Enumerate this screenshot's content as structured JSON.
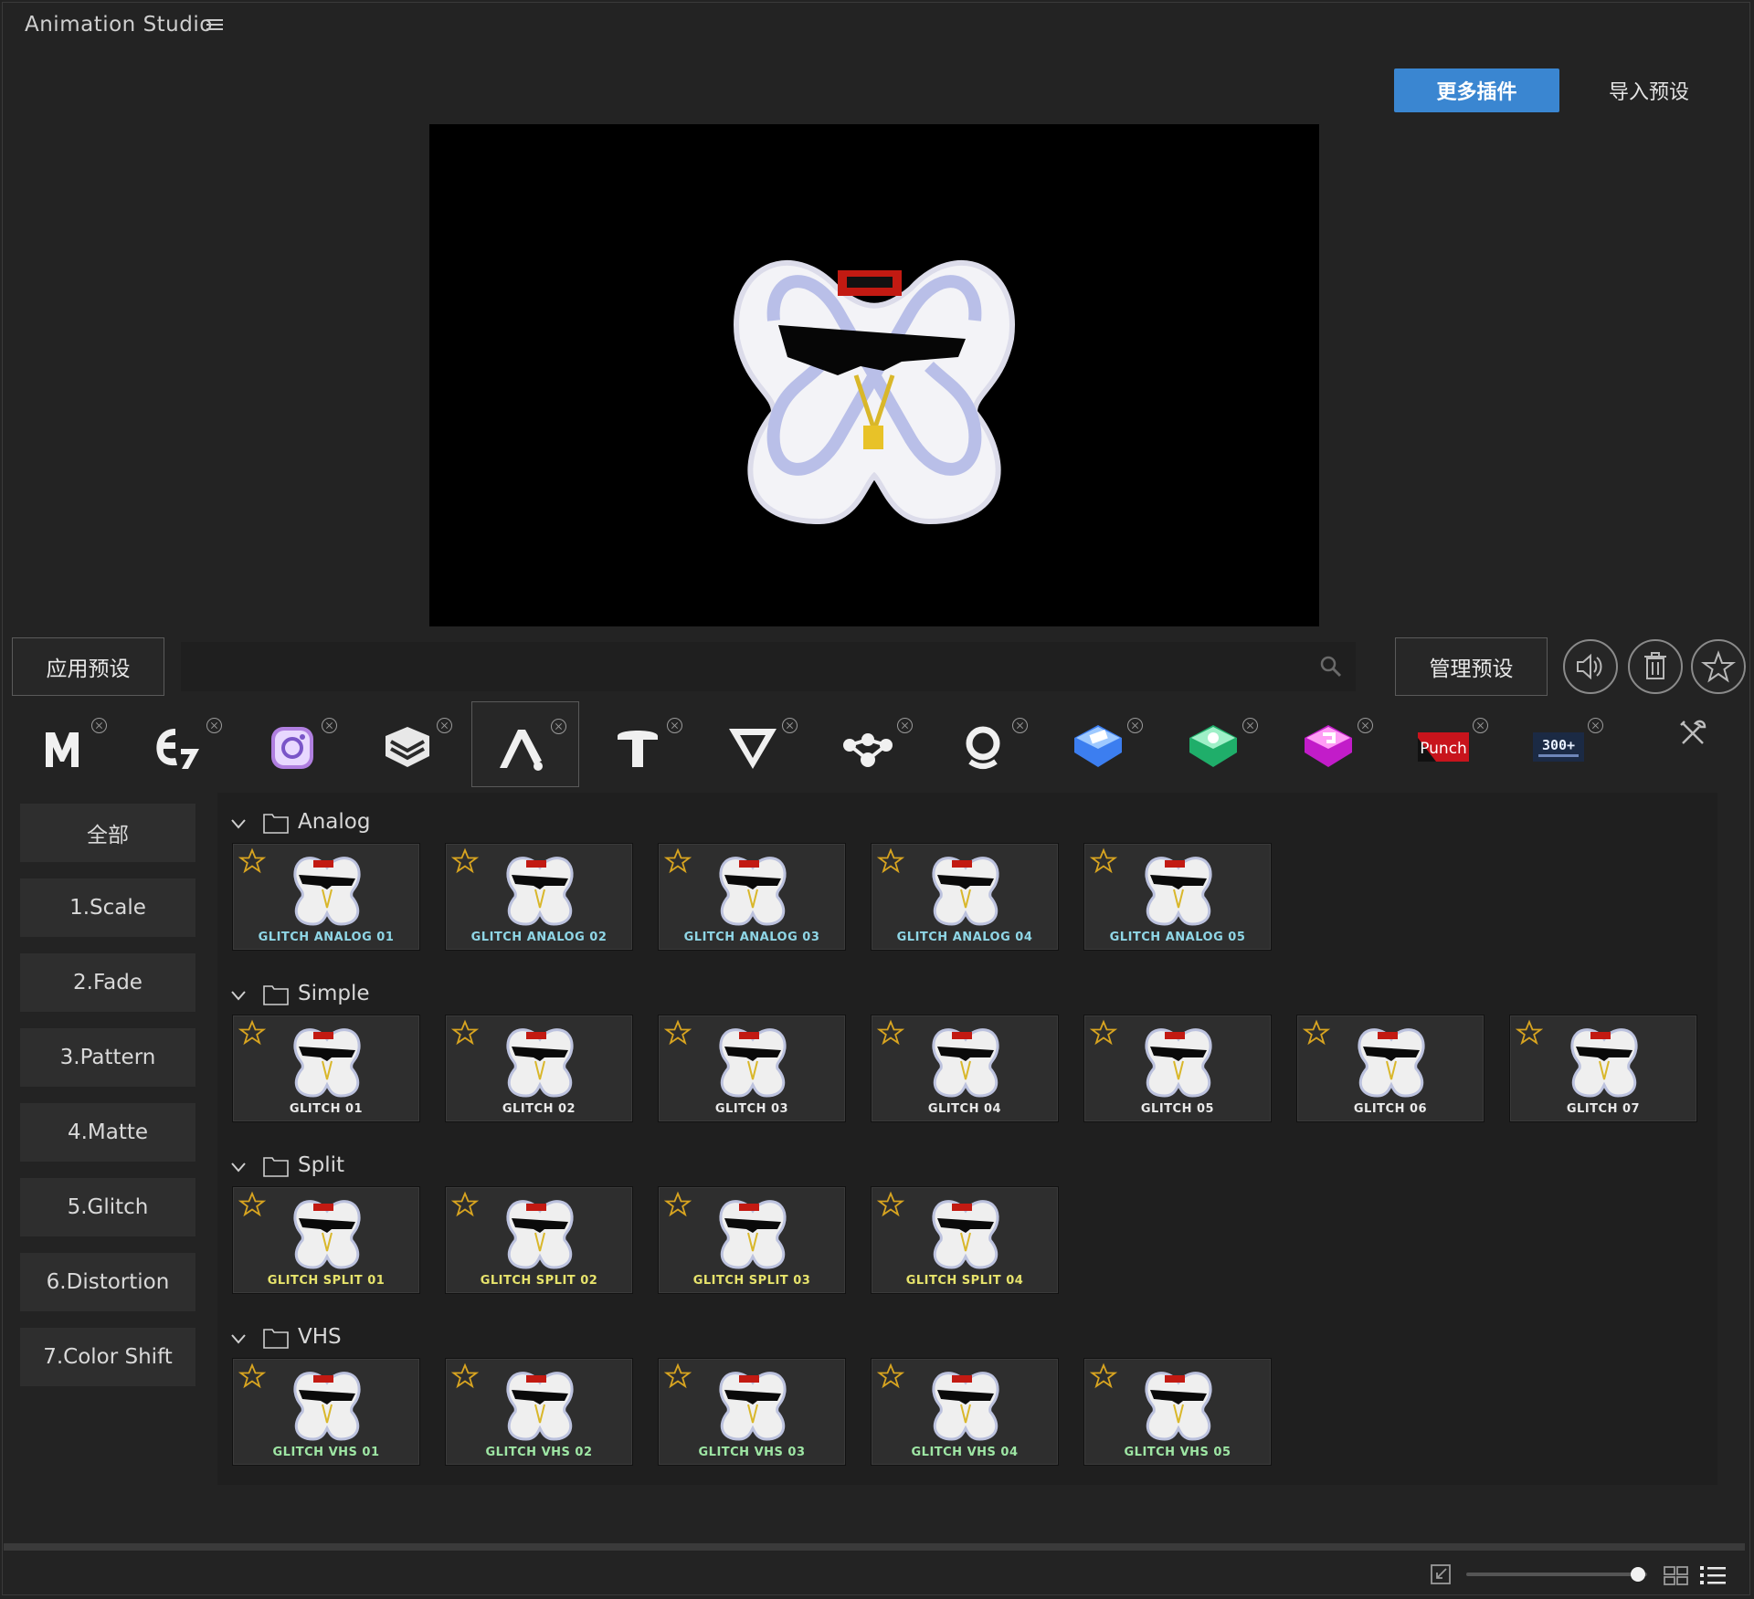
{
  "app": {
    "title": "Animation Studio"
  },
  "header": {
    "more_plugins": "更多插件",
    "import_presets": "导入预设"
  },
  "toolbar": {
    "apply_preset": "应用预设",
    "search_placeholder": "",
    "manage_presets": "管理预设"
  },
  "plugins": [
    {
      "name": "M",
      "icon": "m-logo-icon"
    },
    {
      "name": "E7",
      "icon": "e7-logo-icon"
    },
    {
      "name": "Camera",
      "icon": "camera-logo-icon"
    },
    {
      "name": "Layers",
      "icon": "layers-logo-icon"
    },
    {
      "name": "A",
      "icon": "a-logo-icon",
      "active": true
    },
    {
      "name": "T",
      "icon": "t-logo-icon"
    },
    {
      "name": "V",
      "icon": "v-logo-icon"
    },
    {
      "name": "Nodes",
      "icon": "nodes-logo-icon"
    },
    {
      "name": "Q",
      "icon": "q-logo-icon"
    },
    {
      "name": "Blue box",
      "icon": "blue-box-logo-icon"
    },
    {
      "name": "Green box",
      "icon": "green-box-logo-icon"
    },
    {
      "name": "Pink box",
      "icon": "pink-box-logo-icon"
    },
    {
      "name": "Punch",
      "icon": "punch-logo-icon",
      "text": "Punch"
    },
    {
      "name": "300+",
      "icon": "300-logo-icon",
      "text": "300+"
    }
  ],
  "categories": [
    "全部",
    "1.Scale",
    "2.Fade",
    "3.Pattern",
    "4.Matte",
    "5.Glitch",
    "6.Distortion",
    "7.Color Shift"
  ],
  "groups": [
    {
      "name": "Analog",
      "items": [
        "GLITCH ANALOG 01",
        "GLITCH ANALOG 02",
        "GLITCH ANALOG 03",
        "GLITCH ANALOG 04",
        "GLITCH ANALOG 05"
      ]
    },
    {
      "name": "Simple",
      "items": [
        "GLITCH 01",
        "GLITCH 02",
        "GLITCH 03",
        "GLITCH 04",
        "GLITCH 05",
        "GLITCH 06",
        "GLITCH 07"
      ]
    },
    {
      "name": "Split",
      "items": [
        "GLITCH SPLIT 01",
        "GLITCH SPLIT 02",
        "GLITCH SPLIT 03",
        "GLITCH SPLIT 04"
      ]
    },
    {
      "name": "VHS",
      "items": [
        "GLITCH VHS 01",
        "GLITCH VHS 02",
        "GLITCH VHS 03",
        "GLITCH VHS 04",
        "GLITCH VHS 05"
      ]
    }
  ],
  "footer": {
    "zoom_level": 0.95
  },
  "colors": {
    "accent": "#3a86d1",
    "star": "#d9a520",
    "background": "#232323",
    "panel": "#1f1f1f"
  }
}
